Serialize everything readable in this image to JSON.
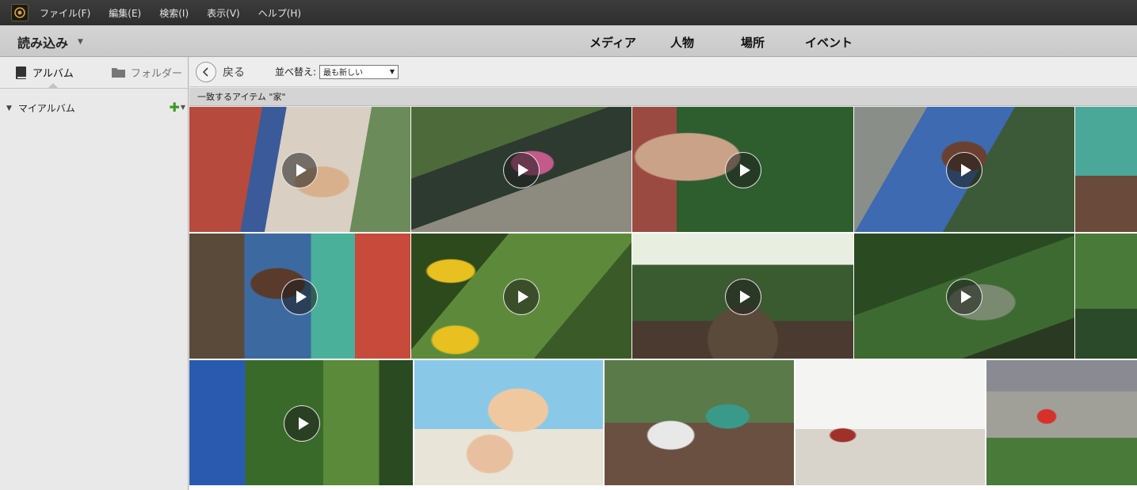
{
  "menubar": {
    "items": [
      "ファイル(F)",
      "編集(E)",
      "検索(I)",
      "表示(V)",
      "ヘルプ(H)"
    ]
  },
  "navbar": {
    "import_label": "読み込み",
    "tabs": [
      "メディア",
      "人物",
      "場所",
      "イベント"
    ]
  },
  "left_panel": {
    "tab_album": "アルバム",
    "tab_folder": "フォルダー",
    "my_albums": "マイアルバム"
  },
  "toolbar": {
    "back_label": "戻る",
    "sort_label": "並べ替え:",
    "sort_value": "最も新しい"
  },
  "result_header": "一致するアイテム \"家\"",
  "colors": {
    "menubar": "#333333",
    "add_icon": "#3a9a2a"
  }
}
